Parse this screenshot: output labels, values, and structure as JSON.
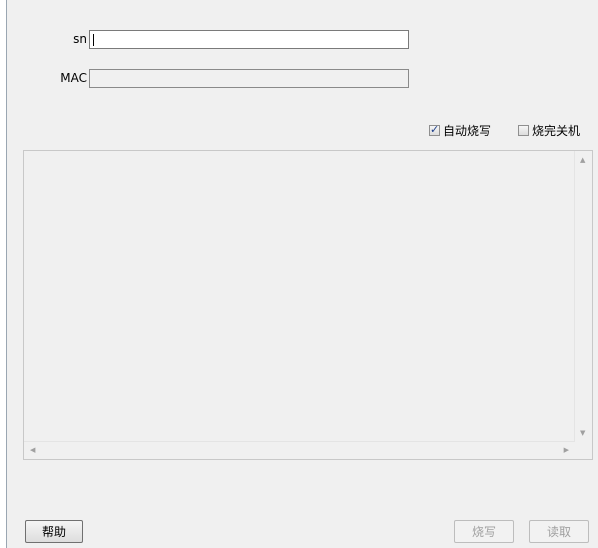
{
  "form": {
    "sn_label": "sn",
    "sn_value": "",
    "mac_label": "MAC",
    "mac_value": ""
  },
  "options": {
    "auto_burn_label": "自动烧写",
    "auto_burn_checked": true,
    "shutdown_label": "烧完关机",
    "shutdown_checked": false
  },
  "buttons": {
    "help_label": "帮助",
    "burn_label": "烧写",
    "read_label": "读取"
  }
}
